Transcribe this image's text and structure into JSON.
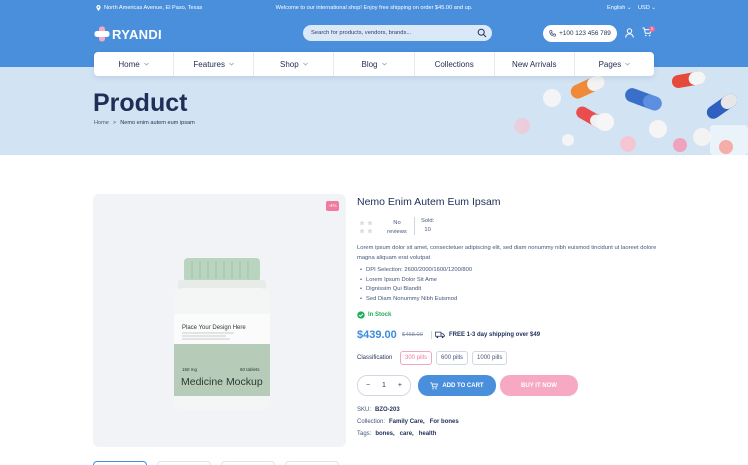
{
  "topbar": {
    "address": "North Americas Avenue, El Paso, Texas",
    "welcome": "Welcome to our international shop! Enjoy free shipping on order $45.00 and up.",
    "language": "English",
    "currency": "USD"
  },
  "header": {
    "logo_text": "RYANDI",
    "search_placeholder": "Search for products, vendors, brands...",
    "phone": "+100 123 456 789",
    "cart_count": "0"
  },
  "nav": [
    {
      "label": "Home",
      "dropdown": true
    },
    {
      "label": "Features",
      "dropdown": true
    },
    {
      "label": "Shop",
      "dropdown": true
    },
    {
      "label": "Blog",
      "dropdown": true
    },
    {
      "label": "Collections",
      "dropdown": false
    },
    {
      "label": "New Arrivals",
      "dropdown": false
    },
    {
      "label": "Pages",
      "dropdown": true
    }
  ],
  "hero": {
    "title": "Product",
    "breadcrumb_home": "Home",
    "breadcrumb_sep": ">",
    "breadcrumb_current": "Nemo enim autem eum ipsam"
  },
  "gallery": {
    "discount_badge": "-4%",
    "bottle_label_top": "Place Your Design Here",
    "bottle_mg": "150 mg",
    "bottle_tablets": "60 tablets",
    "bottle_label_main": "Medicine Mockup"
  },
  "product": {
    "title": "Nemo Enim Autem Eum Ipsam",
    "reviews_line1": "No",
    "reviews_line2": "reviews",
    "sold_label": "Sold:",
    "sold_count": "10",
    "rating": 0,
    "description": "Lorem ipsum dolor sit amet, consectetuer adipiscing elit, sed diam nonummy nibh euismod tincidunt ut laoreet dolore magna aliquam erat volutpat",
    "features": [
      "DPI Selection: 2600/2000/1600/1200/800",
      "Lorem Ipsum Dolor Sit Ame",
      "Dignissim Qui Blandit",
      "Sed Diam Nonummy Nibh Euismod"
    ],
    "stock": "In Stock",
    "price": "$439.00",
    "old_price": "$458.00",
    "shipping": "FREE 1-3 day shipping over $49",
    "classification_label": "Classification",
    "options": [
      "300 pills",
      "600 pills",
      "1000 pills"
    ],
    "selected_option": "300 pills",
    "quantity": "1",
    "qty_minus": "−",
    "qty_plus": "+",
    "add_to_cart": "ADD TO CART",
    "buy_now": "BUY IT NOW",
    "sku_label": "SKU:",
    "sku": "BZO-203",
    "collection_label": "Collection:",
    "collection": "Family Care,   For bones",
    "tags_label": "Tags:",
    "tags": "bones,   care,   health"
  },
  "colors": {
    "primary": "#4a8fdc",
    "accent_pink": "#f07b9e",
    "in_stock": "#1fae5a",
    "navy": "#1d2f57"
  }
}
